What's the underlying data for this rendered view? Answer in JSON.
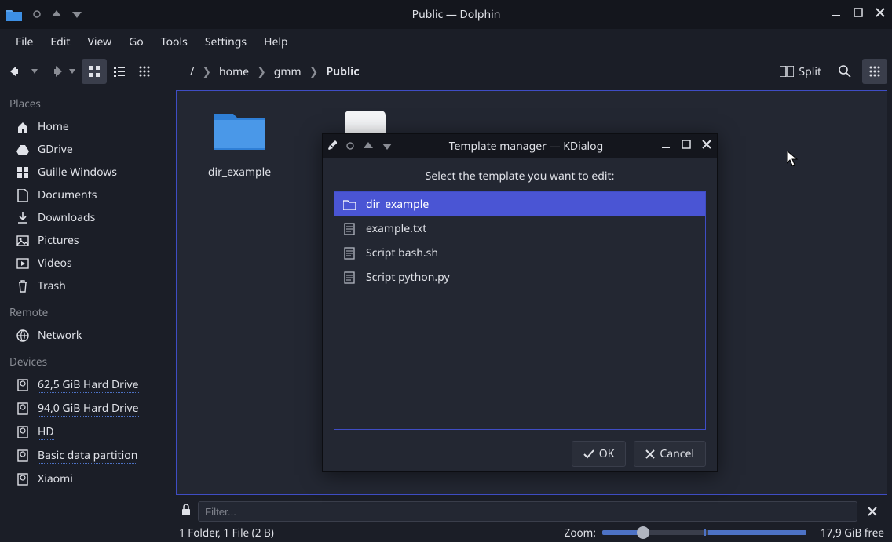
{
  "window": {
    "title": "Public — Dolphin"
  },
  "menu": {
    "file": "File",
    "edit": "Edit",
    "view": "View",
    "go": "Go",
    "tools": "Tools",
    "settings": "Settings",
    "help": "Help"
  },
  "breadcrumb": {
    "root": "/",
    "seg1": "home",
    "seg2": "gmm",
    "seg3": "Public"
  },
  "toolbar": {
    "split": "Split"
  },
  "sidebar": {
    "places_header": "Places",
    "places": [
      {
        "icon": "home",
        "label": "Home"
      },
      {
        "icon": "gdrive",
        "label": "GDrive"
      },
      {
        "icon": "windows",
        "label": "Guille Windows"
      },
      {
        "icon": "doc",
        "label": "Documents"
      },
      {
        "icon": "download",
        "label": "Downloads"
      },
      {
        "icon": "image",
        "label": "Pictures"
      },
      {
        "icon": "video",
        "label": "Videos"
      },
      {
        "icon": "trash",
        "label": "Trash"
      }
    ],
    "remote_header": "Remote",
    "remote": [
      {
        "icon": "network",
        "label": "Network"
      }
    ],
    "devices_header": "Devices",
    "devices": [
      {
        "icon": "disk",
        "label": "62,5 GiB Hard Drive",
        "underline": true
      },
      {
        "icon": "disk",
        "label": "94,0 GiB Hard Drive",
        "underline": true
      },
      {
        "icon": "disk",
        "label": "HD",
        "underline": true
      },
      {
        "icon": "disk",
        "label": "Basic data partition",
        "underline": true
      },
      {
        "icon": "disk",
        "label": "Xiaomi"
      }
    ]
  },
  "files": [
    {
      "icon": "folder",
      "label": "dir_example"
    },
    {
      "icon": "textfile",
      "label": ""
    }
  ],
  "filter": {
    "placeholder": "Filter..."
  },
  "status": {
    "left": "1 Folder, 1 File (2 B)",
    "zoom_label": "Zoom:",
    "free": "17,9 GiB free"
  },
  "dialog": {
    "title": "Template manager — KDialog",
    "prompt": "Select the template you want to edit:",
    "items": [
      {
        "icon": "folder-small",
        "label": "dir_example",
        "selected": true
      },
      {
        "icon": "textfile-small",
        "label": "example.txt"
      },
      {
        "icon": "textfile-small",
        "label": "Script bash.sh"
      },
      {
        "icon": "textfile-small",
        "label": "Script python.py"
      }
    ],
    "ok": "OK",
    "cancel": "Cancel"
  }
}
